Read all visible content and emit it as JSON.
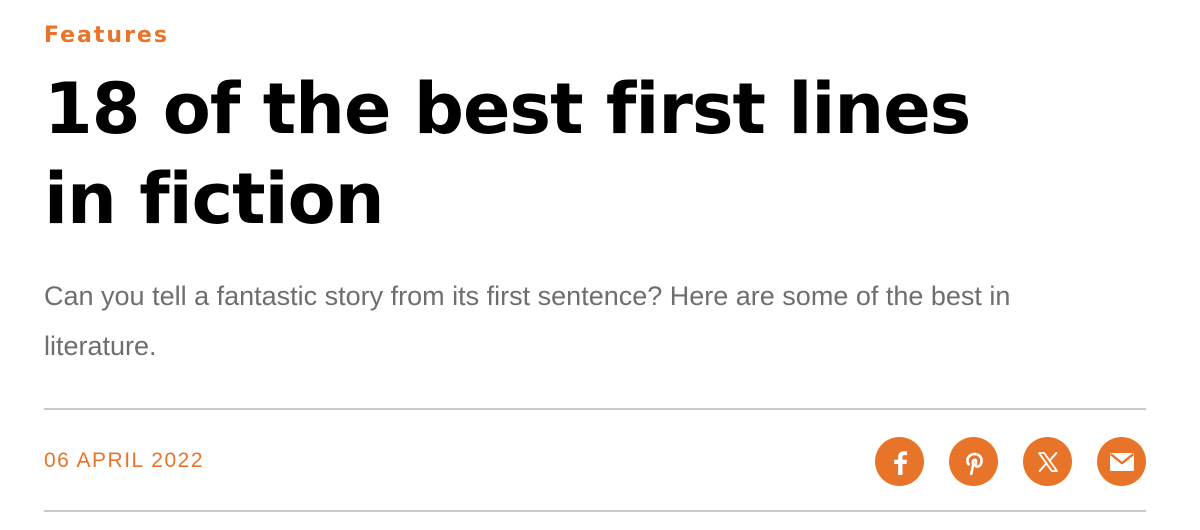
{
  "article": {
    "category": "Features",
    "headline": "18 of the best first lines in fiction",
    "standfirst": "Can you tell a fantastic story from its first sentence? Here are some of the best in literature.",
    "date": "06 APRIL 2022"
  },
  "share": {
    "buttons": [
      {
        "icon": "facebook-icon"
      },
      {
        "icon": "pinterest-icon"
      },
      {
        "icon": "x-icon"
      },
      {
        "icon": "email-icon"
      }
    ]
  },
  "colors": {
    "accent": "#e8742a",
    "headline": "#000000",
    "standfirst": "#6e6e6e",
    "rule": "#c9c9c9"
  }
}
